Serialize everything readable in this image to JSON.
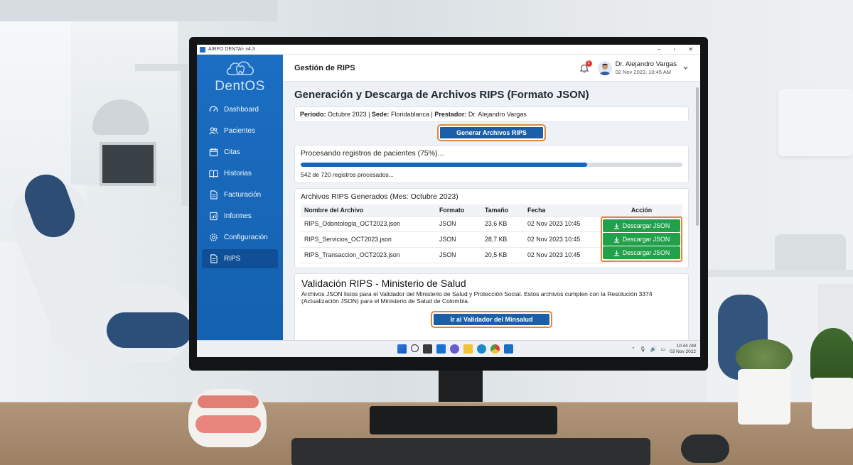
{
  "window": {
    "title": "AIRFO DENTAl- v4.3"
  },
  "brand": {
    "name": "DentOS"
  },
  "sidebar": {
    "items": [
      {
        "label": "Dashboard",
        "icon": "gauge-icon"
      },
      {
        "label": "Pacientes",
        "icon": "users-icon"
      },
      {
        "label": "Citas",
        "icon": "calendar-icon"
      },
      {
        "label": "Historias",
        "icon": "book-icon"
      },
      {
        "label": "Facturación",
        "icon": "document-icon"
      },
      {
        "label": "Informes",
        "icon": "report-icon"
      },
      {
        "label": "Configuración",
        "icon": "gear-icon"
      },
      {
        "label": "RIPS",
        "icon": "file-icon",
        "active": true
      }
    ]
  },
  "header": {
    "title": "Gestión de RIPS",
    "notification_count": "1",
    "user_name": "Dr. Alejandro Vargas",
    "user_date": "02 Nov 2023, 10:45 AM"
  },
  "main": {
    "heading": "Generación y Descarga de Archivos RIPS (Formato JSON)",
    "info": {
      "periodo_label": "Periodo:",
      "periodo_value": "Octubre 2023",
      "sede_label": "Sede:",
      "sede_value": "Floridablanca",
      "prestador_label": "Prestador:",
      "prestador_value": "Dr. Alejandro Vargas"
    },
    "generate_button": "Generar Archivos RIPS",
    "progress": {
      "title": "Procesando registros de pacientes (75%)...",
      "percent": 75,
      "detail": "542 de 720 registros procesados..."
    },
    "files": {
      "title": "Archivos RIPS Generados (Mes: Octubre 2023)",
      "columns": [
        "Nombre del Archivo",
        "Formato",
        "Tamaño",
        "Fecha",
        "Acción"
      ],
      "rows": [
        {
          "name": "RIPS_Odontología_OCT2023.json",
          "format": "JSON",
          "size": "23,6 KB",
          "date": "02 Nov 2023 10:45",
          "action": "Descargar JSON"
        },
        {
          "name": "RIPS_Servicios_OCT2023.json",
          "format": "JSON",
          "size": "28,7 KB",
          "date": "02 Nov 2023 10:45",
          "action": "Descargar JSON"
        },
        {
          "name": "RIPS_Transaccion_OCT2023.json",
          "format": "JSON",
          "size": "20,5 KB",
          "date": "02 Nov 2023 10:45",
          "action": "Descargar JSON"
        }
      ]
    },
    "validation": {
      "title": "Validación RIPS - Ministerio de Salud",
      "text": "Archivos JSON listos para el Validador del Ministerio de Salud y Protección Social. Estos archivos cumplen con la Resolución 3374 (Actualización JSON) para el Ministerio de Salud de Colombia.",
      "button": "Ir al Validador del Minsalud"
    }
  },
  "taskbar": {
    "time": "10:44 AM",
    "date": "03 Nov 2022"
  },
  "colors": {
    "sidebar": "#1b6ec2",
    "primary": "#1a5fa8",
    "success": "#22a04a",
    "highlight": "#e0873b"
  }
}
